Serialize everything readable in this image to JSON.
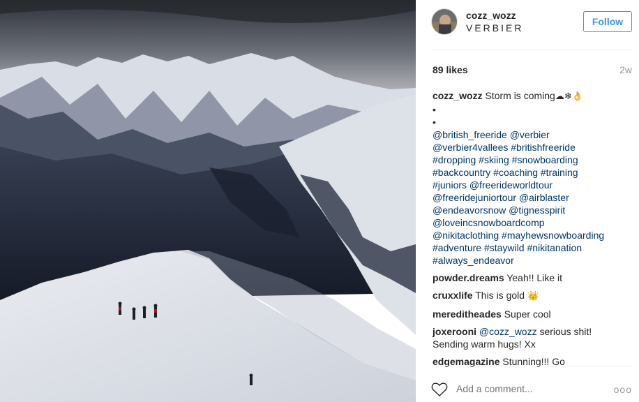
{
  "post": {
    "username": "cozz_wozz",
    "location": "VERBIER",
    "follow_label": "Follow",
    "likes": "89 likes",
    "age": "2w"
  },
  "caption": {
    "handle": "cozz_wozz",
    "text": "Storm is coming",
    "emojis": "☁❄👌",
    "dot1": "•",
    "dot2": "•",
    "lines": [
      [
        "@british_freeride",
        "@verbier"
      ],
      [
        "@verbier4vallees",
        "#britishfreeride"
      ],
      [
        "#dropping",
        "#skiing",
        "#snowboarding"
      ],
      [
        "#backcountry",
        "#coaching",
        "#training"
      ],
      [
        "#juniors",
        "@freerideworldtour"
      ],
      [
        "@freeridejuniortour",
        "@airblaster"
      ],
      [
        "@endeavorsnow",
        "@tignesspirit"
      ],
      [
        "@loveincsnowboardcomp"
      ],
      [
        "@nikitaclothing",
        "#mayhewsnowboarding"
      ],
      [
        "#adventure",
        "#staywild",
        "#nikitanation"
      ],
      [
        "#always_endeavor"
      ]
    ]
  },
  "comments": [
    {
      "user": "powder.dreams",
      "text": "Yeah!! Like it"
    },
    {
      "user": "cruxxlife",
      "text": "This is gold",
      "emoji": "👑"
    },
    {
      "user": "mereditheades",
      "text": "Super cool"
    },
    {
      "user": "joxerooni",
      "mention": "@cozz_wozz",
      "text": "serious shit!",
      "text2": "Sending warm hugs! Xx"
    },
    {
      "user": "edgemagazine",
      "text": "Stunning!!! Go"
    }
  ],
  "comment_box": {
    "placeholder": "Add a comment...",
    "more": "ooo"
  },
  "colors": {
    "link": "#003569",
    "follow": "#3897f0",
    "muted": "#999999"
  }
}
